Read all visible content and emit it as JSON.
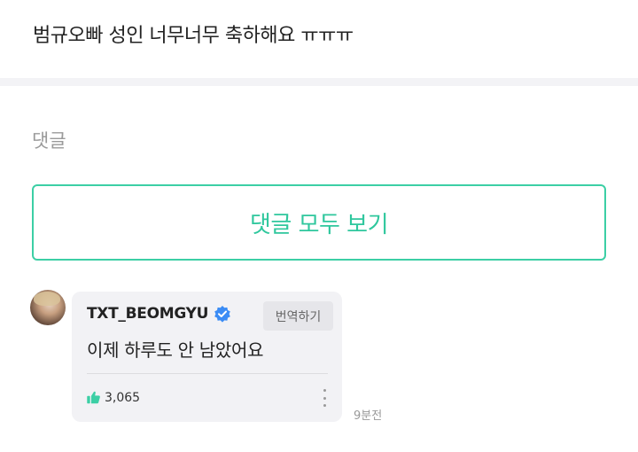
{
  "post": {
    "text": "범규오빠 성인 너무너무 축하해요 ㅠㅠㅠ"
  },
  "comments_section": {
    "label": "댓글",
    "view_all_label": "댓글 모두 보기"
  },
  "comment": {
    "author": "TXT_BEOMGYU",
    "verified_icon": "verified-badge-icon",
    "translate_label": "번역하기",
    "text": "이제 하루도 안 남았어요",
    "like_icon": "thumbs-up-icon",
    "like_count": "3,065",
    "more_icon": "more-vertical-icon",
    "timestamp": "9분전"
  },
  "colors": {
    "accent": "#2fc79d",
    "verified": "#3b8cf5",
    "like": "#3ccfa5"
  }
}
